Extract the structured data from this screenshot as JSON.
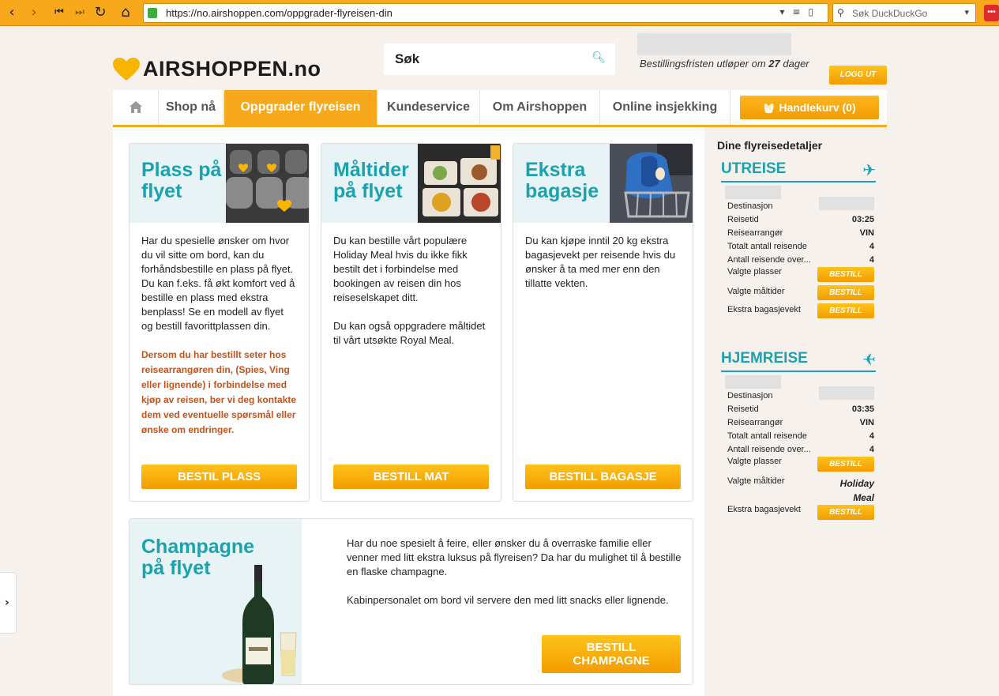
{
  "browser": {
    "url": "https://no.airshoppen.com/oppgrader-flyreisen-din",
    "search_placeholder": "Søk DuckDuckGo",
    "ext_label": "•••"
  },
  "header": {
    "logo_text": "AIRSHOPPEN.no",
    "search_label": "Søk",
    "deadline_prefix": "Bestillingsfristen utløper om",
    "deadline_days": "27",
    "deadline_suffix": "dager",
    "logout_label": "LOGG UT"
  },
  "nav": {
    "items": [
      "Shop nå",
      "Oppgrader flyreisen",
      "Kundeservice",
      "Om Airshoppen",
      "Online insjekking"
    ],
    "cart_label": "Handlekurv (0)"
  },
  "cards": [
    {
      "title_line1": "Plass på",
      "title_line2": "flyet",
      "body": "Har du spesielle ønsker om hvor du vil sitte om bord, kan du forhåndsbestille en plass på flyet. Du kan f.eks. få økt komfort ved å bestille en plass med ekstra benplass! Se en modell av flyet og bestill favorittplassen din.",
      "warning": "Dersom du har bestillt seter hos reisearrangøren din, (Spies, Ving eller lignende) i forbindelse med kjøp av reisen, ber vi deg kontakte dem ved eventuelle spørsmål eller ønske om endringer.",
      "button": "BESTIL PLASS"
    },
    {
      "title_line1": "Måltider",
      "title_line2": "på flyet",
      "body": "Du kan bestille vårt populære Holiday Meal hvis du ikke fikk bestilt det i forbindelse med bookingen av reisen din hos reiseselskapet ditt.",
      "body2": "Du kan også oppgradere måltidet til vårt utsøkte Royal Meal.",
      "button": "BESTILL MAT"
    },
    {
      "title_line1": "Ekstra",
      "title_line2": "bagasje",
      "body": "Du kan kjøpe inntil 20 kg ekstra bagasjevekt per reisende hvis du ønsker å ta med mer enn den tillatte vekten.",
      "button": "BESTILL BAGASJE"
    }
  ],
  "champagne": {
    "title_line1": "Champagne",
    "title_line2": "på flyet",
    "text1": "Har du noe spesielt å feire, eller ønsker du å overraske familie eller venner med litt ekstra luksus på flyreisen? Da har du mulighet til å bestille en flaske champagne.",
    "text2": "Kabinpersonalet om bord vil servere den med litt snacks eller lignende.",
    "button_line1": "BESTILL",
    "button_line2": "CHAMPAGNE"
  },
  "sidebar": {
    "title": "Dine flyreisedetaljer",
    "outbound": {
      "heading": "UTREISE",
      "rows": {
        "destination": "Destinasjon",
        "traveltime": "Reisetid",
        "traveltime_value": "03:25",
        "operator": "Reisearrangør",
        "operator_value": "VIN",
        "total_travelers": "Totalt antall reisende",
        "total_travelers_value": "4",
        "travelers_over": "Antall reisende over...",
        "travelers_over_value": "4",
        "seats": "Valgte plasser",
        "meals": "Valgte måltider",
        "baggage": "Ekstra bagasjevekt"
      },
      "button": "BESTILL"
    },
    "return": {
      "heading": "HJEMREISE",
      "rows": {
        "destination": "Destinasjon",
        "traveltime": "Reisetid",
        "traveltime_value": "03:35",
        "operator": "Reisearrangør",
        "operator_value": "VIN",
        "total_travelers": "Totalt antall reisende",
        "total_travelers_value": "4",
        "travelers_over": "Antall reisende over...",
        "travelers_over_value": "4",
        "seats": "Valgte plasser",
        "meals": "Valgte måltider",
        "meals_value_line1": "Holiday",
        "meals_value_line2": "Meal",
        "baggage": "Ekstra bagasjevekt"
      },
      "button": "BESTILL"
    }
  },
  "colors": {
    "accent": "#f7a81b",
    "teal": "#1aa2ae",
    "warning": "#c4521a"
  }
}
